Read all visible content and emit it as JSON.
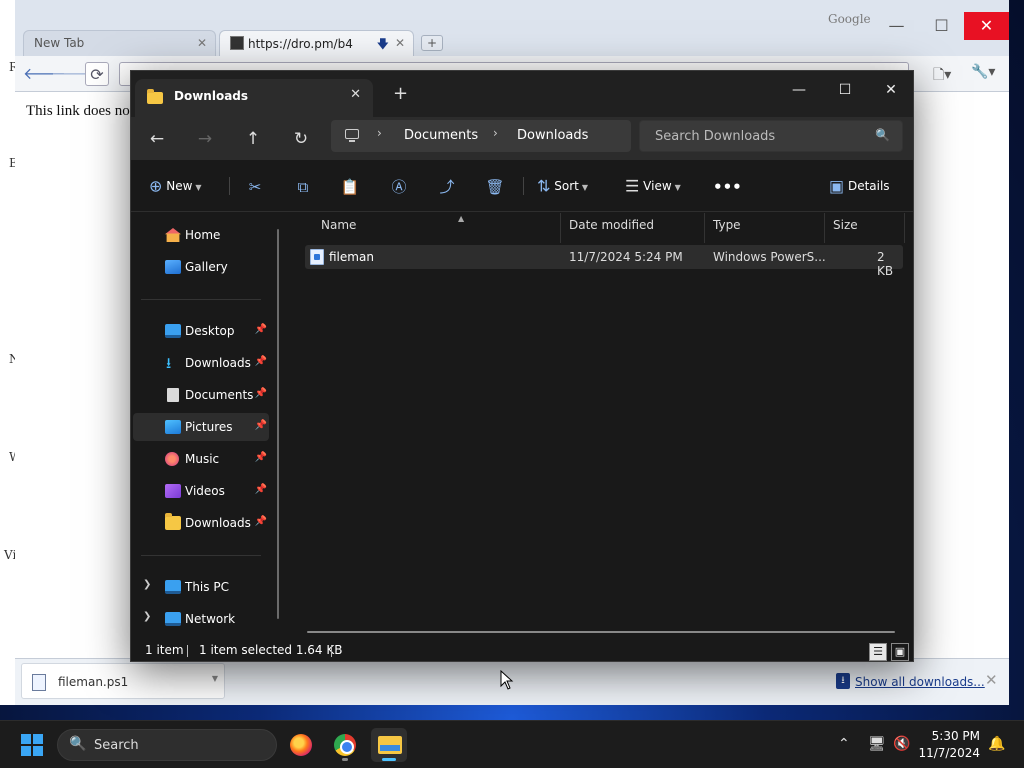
{
  "desktop": {
    "edge_letters": [
      "R",
      "E",
      "N",
      "W",
      "Vi"
    ]
  },
  "browser": {
    "watermark": "Google",
    "tabs": [
      {
        "label": "New Tab"
      },
      {
        "label": "https://dro.pm/b4"
      }
    ],
    "address_text": "https://dro.pm/b4",
    "page_text": "This link does not",
    "download_item": "fileman.ps1",
    "show_all_downloads": "Show all downloads..."
  },
  "explorer": {
    "tab_title": "Downloads",
    "breadcrumb": [
      "Documents",
      "Downloads"
    ],
    "search_placeholder": "Search Downloads",
    "commands": {
      "new": "New",
      "sort": "Sort",
      "view": "View",
      "details": "Details"
    },
    "sidebar": {
      "quick": [
        {
          "label": "Home"
        },
        {
          "label": "Gallery"
        }
      ],
      "pinned": [
        {
          "label": "Desktop"
        },
        {
          "label": "Downloads"
        },
        {
          "label": "Documents"
        },
        {
          "label": "Pictures"
        },
        {
          "label": "Music"
        },
        {
          "label": "Videos"
        },
        {
          "label": "Downloads"
        }
      ],
      "tree": [
        {
          "label": "This PC"
        },
        {
          "label": "Network"
        }
      ]
    },
    "columns": [
      "Name",
      "Date modified",
      "Type",
      "Size"
    ],
    "files": [
      {
        "name": "fileman",
        "date": "11/7/2024 5:24 PM",
        "type": "Windows PowerS...",
        "size": "2 KB"
      }
    ],
    "status": {
      "count": "1 item",
      "selected": "1 item selected  1.64 KB"
    }
  },
  "taskbar": {
    "search_label": "Search",
    "time": "5:30 PM",
    "date": "11/7/2024"
  },
  "colors": {
    "accent": "#4cc2ff",
    "close_red": "#e81123",
    "folder": "#f6c744"
  }
}
